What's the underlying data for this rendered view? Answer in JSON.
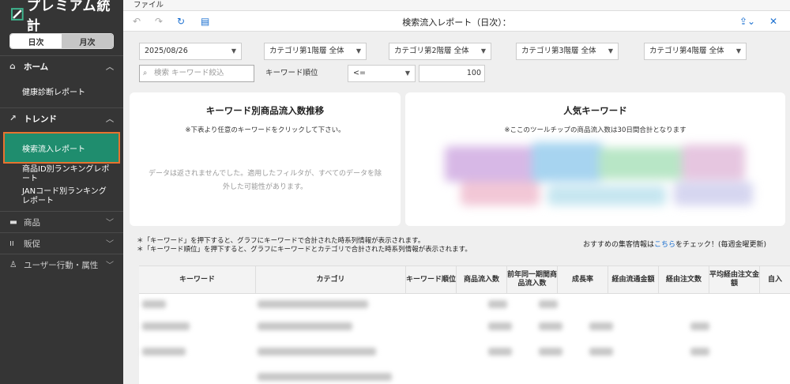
{
  "brand": {
    "name": "プレミアム統計",
    "accent": "#1f8d6e"
  },
  "period_toggle": {
    "daily": "日次",
    "monthly": "月次"
  },
  "sidebar": {
    "home": {
      "label": "ホーム",
      "items": [
        "健康診断レポート"
      ]
    },
    "trend": {
      "label": "トレンド",
      "items": [
        "検索流入レポート",
        "商品ID別ランキングレポート",
        "JANコード別ランキングレポート"
      ]
    },
    "products": "商品",
    "promotion": "販促",
    "user_behavior": "ユーザー行動・属性"
  },
  "menu": {
    "file": "ファイル"
  },
  "toolbar": {
    "title": "検索流入レポート（日次）："
  },
  "filters": {
    "date": "2025/08/26",
    "category1": "カテゴリ第1階層 全体",
    "category2": "カテゴリ第2階層 全体",
    "category3": "カテゴリ第3階層 全体",
    "category4": "カテゴリ第4階層 全体",
    "search_placeholder": "検索 キーワード絞込",
    "rank_label": "キーワード順位",
    "operator": "<=",
    "rank_value": "100"
  },
  "left_card": {
    "title": "キーワード別商品流入数推移",
    "sub": "※下表より任意のキーワードをクリックして下さい。",
    "empty_line1": "データは返されませんでした。適用したフィルタが、すべてのデータを除",
    "empty_line2": "外した可能性があります。"
  },
  "right_card": {
    "title": "人気キーワード",
    "sub": "※ここのツールチップの商品流入数は30日間合計となります"
  },
  "notes": {
    "line1": "＊「キーワード」を押下すると、グラフにキーワードで合計された時系列情報が表示されます。",
    "line2": "＊「キーワード順位」を押下すると、グラフにキーワードとカテゴリで合計された時系列情報が表示されます。",
    "rec_prefix": "おすすめの集客情報は",
    "rec_link": "こちら",
    "rec_suffix": "をチェック！(毎週金曜更新)"
  },
  "table": {
    "headers": [
      "キーワード",
      "カテゴリ",
      "キーワード順位",
      "商品流入数",
      "前年同一期間商品流入数",
      "成長率",
      "経由流通金額",
      "経由注文数",
      "平均経由注文金額",
      "自入"
    ]
  }
}
